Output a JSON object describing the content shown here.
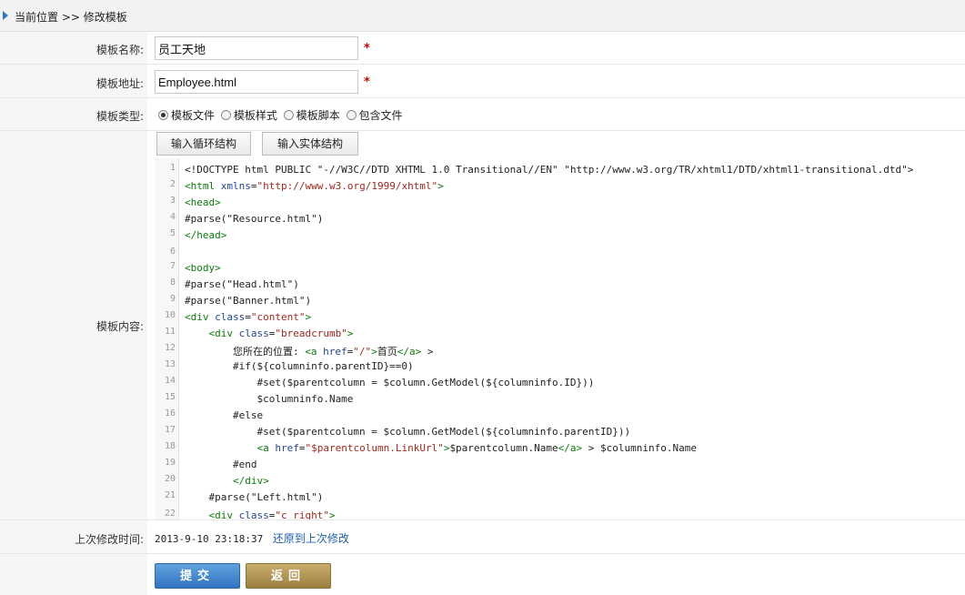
{
  "breadcrumb": {
    "prefix": "当前位置",
    "separator": ">>",
    "current": "修改模板"
  },
  "form": {
    "name_label": "模板名称:",
    "name_value": "员工天地",
    "address_label": "模板地址:",
    "address_value": "Employee.html",
    "required_mark": "*",
    "type_label": "模板类型:",
    "type_options": [
      "模板文件",
      "模板样式",
      "模板脚本",
      "包含文件"
    ],
    "type_selected": "模板文件",
    "content_label": "模板内容:",
    "insert_loop_label": "输入循环结构",
    "insert_entity_label": "输入实体结构",
    "last_modified_label": "上次修改时间:",
    "last_modified_value": "2013-9-10 23:18:37",
    "restore_label": "还原到上次修改"
  },
  "code_lines": [
    {
      "n": "1",
      "parts": [
        [
          "plain",
          "<!DOCTYPE html PUBLIC \"-//W3C//DTD XHTML 1.0 Transitional//EN\" \"http://www.w3.org/TR/xhtml1/DTD/xhtml1-transitional.dtd\">"
        ]
      ]
    },
    {
      "n": "2",
      "parts": [
        [
          "tag",
          "<html "
        ],
        [
          "att",
          "xmlns"
        ],
        [
          "plain",
          "="
        ],
        [
          "str",
          "\"http://www.w3.org/1999/xhtml\""
        ],
        [
          "tag",
          ">"
        ]
      ]
    },
    {
      "n": "3",
      "parts": [
        [
          "tag",
          "<head>"
        ]
      ]
    },
    {
      "n": "4",
      "parts": [
        [
          "plain",
          "#parse(\"Resource.html\")"
        ]
      ]
    },
    {
      "n": "5",
      "parts": [
        [
          "tag",
          "</head>"
        ]
      ]
    },
    {
      "n": "6",
      "parts": []
    },
    {
      "n": "7",
      "parts": [
        [
          "tag",
          "<body>"
        ]
      ]
    },
    {
      "n": "8",
      "parts": [
        [
          "plain",
          "#parse(\"Head.html\")"
        ]
      ]
    },
    {
      "n": "9",
      "parts": [
        [
          "plain",
          "#parse(\"Banner.html\")"
        ]
      ]
    },
    {
      "n": "10",
      "parts": [
        [
          "tag",
          "<div "
        ],
        [
          "att",
          "class"
        ],
        [
          "plain",
          "="
        ],
        [
          "str",
          "\"content\""
        ],
        [
          "tag",
          ">"
        ]
      ]
    },
    {
      "n": "11",
      "parts": [
        [
          "plain",
          "    "
        ],
        [
          "tag",
          "<div "
        ],
        [
          "att",
          "class"
        ],
        [
          "plain",
          "="
        ],
        [
          "str",
          "\"breadcrumb\""
        ],
        [
          "tag",
          ">"
        ]
      ]
    },
    {
      "n": "12",
      "parts": [
        [
          "plain",
          "        您所在的位置: "
        ],
        [
          "tag",
          "<a "
        ],
        [
          "att",
          "href"
        ],
        [
          "plain",
          "="
        ],
        [
          "str",
          "\"/\""
        ],
        [
          "tag",
          ">"
        ],
        [
          "plain",
          "首页"
        ],
        [
          "tag",
          "</a>"
        ],
        [
          "plain",
          " >"
        ]
      ]
    },
    {
      "n": "13",
      "parts": [
        [
          "plain",
          "        #if(${columninfo.parentID}==0)"
        ]
      ]
    },
    {
      "n": "14",
      "parts": [
        [
          "plain",
          "            #set($parentcolumn = $column.GetModel(${columninfo.ID}))"
        ]
      ]
    },
    {
      "n": "15",
      "parts": [
        [
          "plain",
          "            $columninfo.Name"
        ]
      ]
    },
    {
      "n": "16",
      "parts": [
        [
          "plain",
          "        #else"
        ]
      ]
    },
    {
      "n": "17",
      "parts": [
        [
          "plain",
          "            #set($parentcolumn = $column.GetModel(${columninfo.parentID}))"
        ]
      ]
    },
    {
      "n": "18",
      "parts": [
        [
          "plain",
          "            "
        ],
        [
          "tag",
          "<a "
        ],
        [
          "att",
          "href"
        ],
        [
          "plain",
          "="
        ],
        [
          "str",
          "\"$parentcolumn.LinkUrl\""
        ],
        [
          "tag",
          ">"
        ],
        [
          "plain",
          "$parentcolumn.Name"
        ],
        [
          "tag",
          "</a>"
        ],
        [
          "plain",
          " > $columninfo.Name"
        ]
      ]
    },
    {
      "n": "19",
      "parts": [
        [
          "plain",
          "        #end"
        ]
      ]
    },
    {
      "n": "20",
      "parts": [
        [
          "plain",
          "        "
        ],
        [
          "tag",
          "</div>"
        ]
      ]
    },
    {
      "n": "21",
      "parts": [
        [
          "plain",
          "    #parse(\"Left.html\")"
        ]
      ]
    },
    {
      "n": "22",
      "parts": [
        [
          "plain",
          "    "
        ],
        [
          "tag",
          "<div "
        ],
        [
          "att",
          "class"
        ],
        [
          "plain",
          "="
        ],
        [
          "str",
          "\"c_right\""
        ],
        [
          "tag",
          ">"
        ]
      ]
    }
  ],
  "buttons": {
    "submit_label": "提交",
    "back_label": "返回"
  },
  "colors": {
    "accent_blue": "#2f74c0",
    "gold": "#9c8040",
    "required_red": "#cc0000"
  }
}
